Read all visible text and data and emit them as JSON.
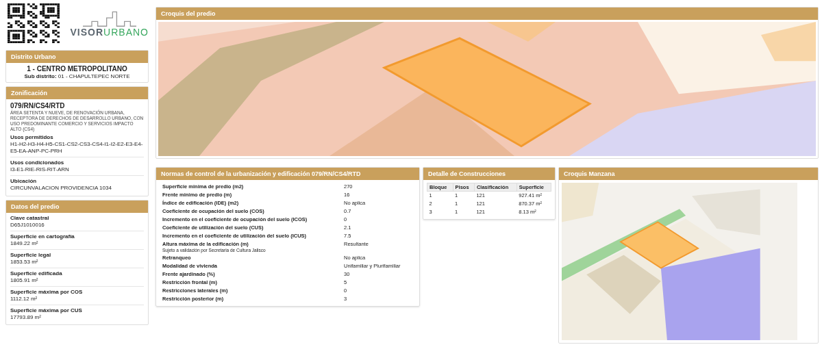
{
  "logo": {
    "part_dark": "VISOR",
    "part_green": "URBANO"
  },
  "distrito": {
    "title": "Distrito Urbano",
    "name": "1 - CENTRO METROPOLITANO",
    "sub_label": "Sub distrito:",
    "sub_value": "01 - CHAPULTEPEC NORTE"
  },
  "zonificacion": {
    "title": "Zonificación",
    "code": "079/RN/CS4/RTD",
    "description": "ÁREA SETENTA Y NUEVE, DE RENOVACIÓN URBANA, RECEPTORA DE DERECHOS DE DESARROLLO URBANO, CON USO PREDOMINANTE COMERCIO Y SERVICIOS IMPACTO ALTO (CS4)",
    "fields": [
      {
        "label": "Usos permitidos",
        "value": "H1-H2-H3-H4-H5-CS1-CS2-CS3-CS4-I1-I2-E2-E3-E4-E5-EA-ANP-PC-PRH"
      },
      {
        "label": "Usos condicionados",
        "value": "I3-E1-RIE-RIS-RIT-ARN"
      },
      {
        "label": "Ubicación",
        "value": "CIRCUNVALACION PROVIDENCIA 1034"
      }
    ]
  },
  "datos": {
    "title": "Datos del predio",
    "fields": [
      {
        "label": "Clave catastral",
        "value": "D65J1010016"
      },
      {
        "label": "Superficie en cartografía",
        "value": "1849.22 m²"
      },
      {
        "label": "Superficie legal",
        "value": "1853.53 m²"
      },
      {
        "label": "Superficie edificada",
        "value": "1805.91 m²"
      },
      {
        "label": "Superficie máxima por COS",
        "value": "1112.12 m²"
      },
      {
        "label": "Superficie máxima por CUS",
        "value": "17793.89 m²"
      }
    ]
  },
  "croquis_predio": {
    "title": "Croquis del predio"
  },
  "normas": {
    "title": "Normas de control de la urbanización y edificación 079/RN/CS4/RTD",
    "rows": [
      {
        "label": "Superficie minima de predio (m2)",
        "value": "270"
      },
      {
        "label": "Frente minimo de predio (m)",
        "value": "16"
      },
      {
        "label": "Índice de edificación (IDE) (m2)",
        "value": "No aplica"
      },
      {
        "label": "Coeficiente de ocupación del suelo (COS)",
        "value": "0.7"
      },
      {
        "label": "Incremento en el coeficiente de ocupación del suelo (ICOS)",
        "value": "0"
      },
      {
        "label": "Coeficiente de utilización del suelo (CUS)",
        "value": "2.1"
      },
      {
        "label": "Incremento en el coeficiente de utilización del suelo (ICUS)",
        "value": "7.5"
      },
      {
        "label": "Altura máxima de la edificación (m)",
        "note": "Sujeto a validación por Secretaria de Cultura Jalisco",
        "value": "Resultante"
      },
      {
        "label": "Retranqueo",
        "value": "No aplica"
      },
      {
        "label": "Modalidad de vivienda",
        "value": "Unifamiliar y Plurifamiliar"
      },
      {
        "label": "Frente ajardinado (%)",
        "value": "30"
      },
      {
        "label": "Restricción frontal (m)",
        "value": "5"
      },
      {
        "label": "Restricciones laterales (m)",
        "value": "0"
      },
      {
        "label": "Restricción posterior (m)",
        "value": "3"
      }
    ]
  },
  "construcciones": {
    "title": "Detalle de Construcciones",
    "columns": [
      "Bloque",
      "Pisos",
      "Clasificación",
      "Superficie"
    ],
    "rows": [
      [
        "1",
        "1",
        "121",
        "927.41 m²"
      ],
      [
        "2",
        "1",
        "121",
        "870.37 m²"
      ],
      [
        "3",
        "1",
        "121",
        "8.13 m²"
      ]
    ]
  },
  "croquis_manzana": {
    "title": "Croquis Manzana"
  }
}
